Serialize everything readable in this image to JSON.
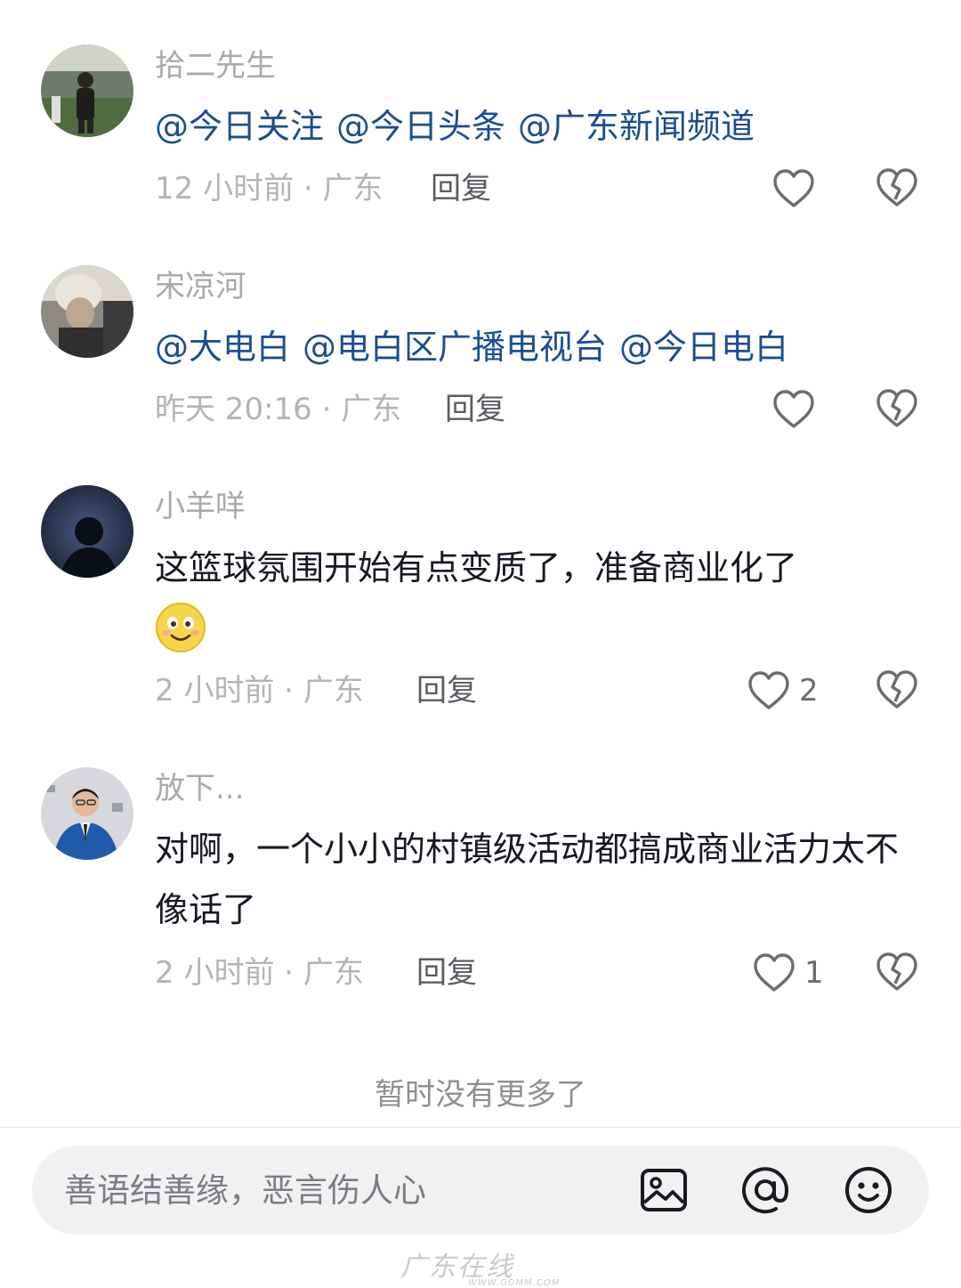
{
  "comments": [
    {
      "username": "拾二先生",
      "mentions": [
        "@今日关注",
        "@今日头条",
        "@广东新闻频道"
      ],
      "time_location": "12 小时前 · 广东",
      "reply_label": "回复",
      "like_count": ""
    },
    {
      "username": "宋凉河",
      "mentions": [
        "@大电白",
        "@电白区广播电视台",
        "@今日电白"
      ],
      "time_location": "昨天 20:16 · 广东",
      "reply_label": "回复",
      "like_count": ""
    },
    {
      "username": "小羊咩",
      "text": "这篮球氛围开始有点变质了，准备商业化了",
      "emoji": "smiley-emoji",
      "time_location": "2 小时前 · 广东",
      "reply_label": "回复",
      "like_count": "2"
    },
    {
      "username": "放下...",
      "text": "对啊，一个小小的村镇级活动都搞成商业活力太不像话了",
      "time_location": "2 小时前 · 广东",
      "reply_label": "回复",
      "like_count": "1"
    }
  ],
  "footer_note": "暂时没有更多了",
  "input": {
    "placeholder": "善语结善缘，恶言伤人心"
  },
  "toolbar_icons": [
    "image-icon",
    "at-icon",
    "emoji-icon"
  ],
  "watermark": {
    "text": "广东在线",
    "url": "WWW.GDMM.COM"
  },
  "colors": {
    "mention": "#1c4e8f",
    "secondary_text": "#a9a9ae",
    "input_bg": "#f1f1f3"
  }
}
